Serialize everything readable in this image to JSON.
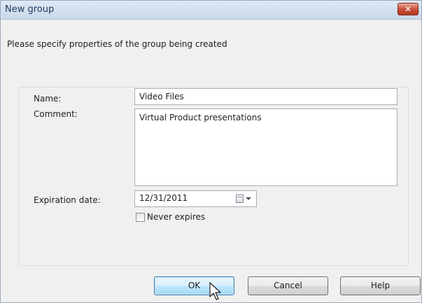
{
  "window": {
    "title": "New group",
    "close_glyph": "✕",
    "close_icon": "close-icon",
    "title_color": "#1e3a5f",
    "close_color": "#c64a35"
  },
  "instruction": "Please specify properties of the group being created",
  "form": {
    "name_label": "Name:",
    "name_value": "Video Files",
    "comment_label": "Comment:",
    "comment_value": "Virtual Product presentations",
    "expiration_label": "Expiration date:",
    "expiration_value": "12/31/2011",
    "calendar_icon": "calendar-icon",
    "dropdown_icon": "chevron-down-icon",
    "never_expires_label": "Never expires",
    "never_expires_checked": false
  },
  "buttons": {
    "ok": "OK",
    "cancel": "Cancel",
    "help": "Help",
    "default_accent": "#3c7fb1"
  },
  "cursor": {
    "icon": "mouse-pointer-icon"
  }
}
